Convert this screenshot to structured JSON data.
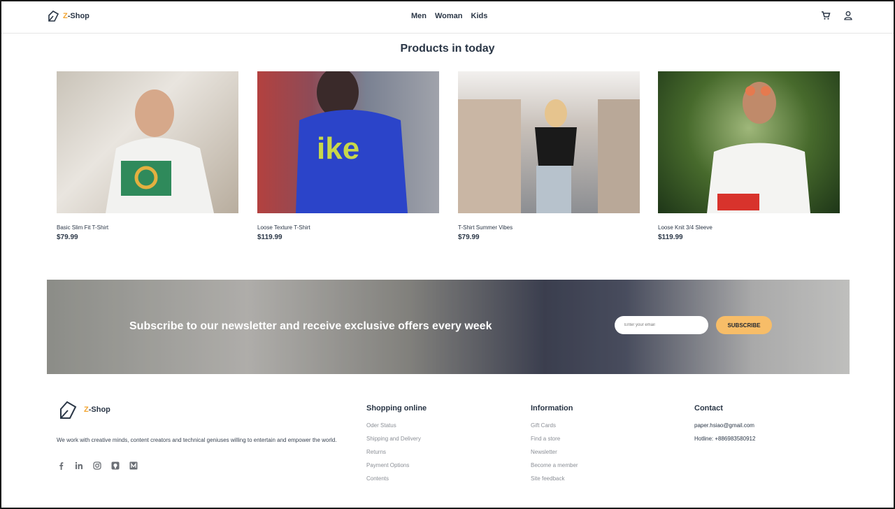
{
  "brand": {
    "prefix": "Z",
    "name": "-Shop"
  },
  "nav": [
    "Men",
    "Woman",
    "Kids"
  ],
  "header_icons": [
    "cart-icon",
    "user-icon"
  ],
  "section_title": "Products in today",
  "products": [
    {
      "name": "Basic Slim Fit T-Shirt",
      "price": "$79.99"
    },
    {
      "name": "Loose Texture T-Shirt",
      "price": "$119.99"
    },
    {
      "name": "T-Shirt Summer Vibes",
      "price": "$79.99"
    },
    {
      "name": "Loose Knit 3/4 Sleeve",
      "price": "$119.99"
    }
  ],
  "newsletter": {
    "text": "Subscribe to our newsletter and receive exclusive offers every week",
    "placeholder": "Enter your email",
    "button": "SUBSCRIBE"
  },
  "footer": {
    "description": "We work with creative minds, content creators and technical geniuses willing to entertain and empower the world.",
    "socials": [
      "facebook-icon",
      "linkedin-icon",
      "instagram-icon",
      "github-icon",
      "medium-icon"
    ],
    "shopping": {
      "title": "Shopping online",
      "links": [
        "Oder Status",
        "Shipping and Delivery",
        "Returns",
        "Payment Options",
        "Contents"
      ]
    },
    "information": {
      "title": "Information",
      "links": [
        "Gift Cards",
        "Find a store",
        "Newsletter",
        "Become a member",
        "Site feedback"
      ]
    },
    "contact": {
      "title": "Contact",
      "email": "paper.hsiao@gmail.com",
      "hotline": "Hotline: +886983580912"
    }
  },
  "colors": {
    "accent": "#f3a531",
    "button": "#f7bd68",
    "text": "#2a3646"
  }
}
